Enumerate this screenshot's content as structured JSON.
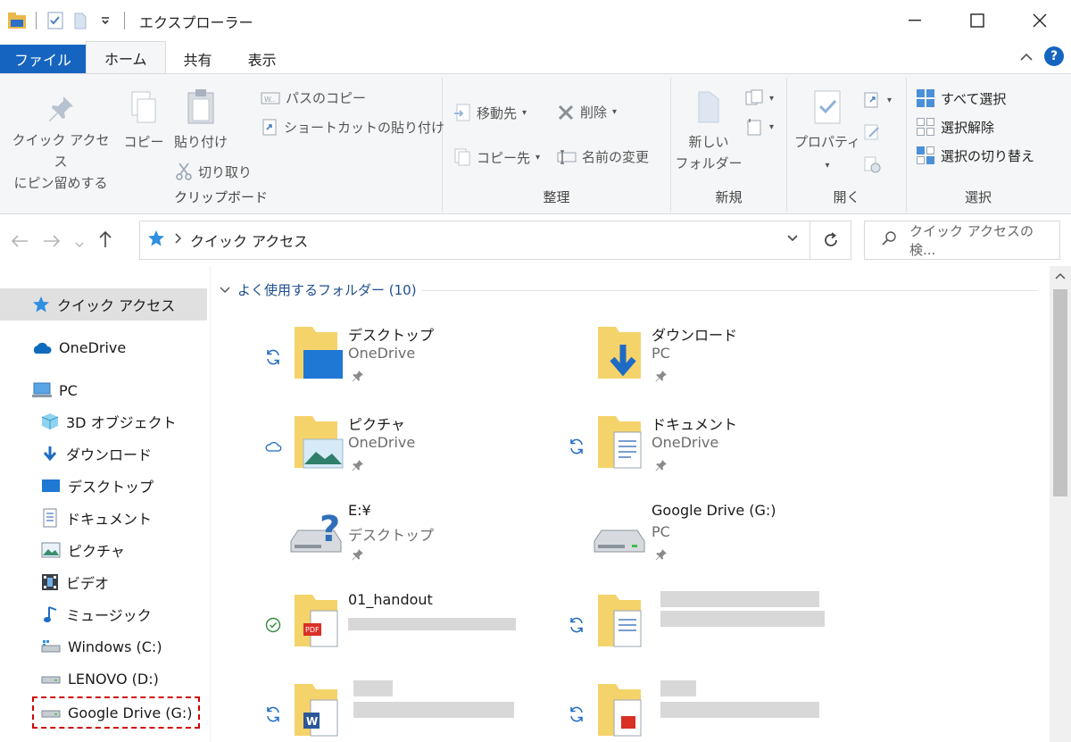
{
  "window": {
    "title": "エクスプローラー",
    "controls": {
      "minimize": "—",
      "maximize": "☐",
      "close": "✕"
    }
  },
  "tabs": [
    {
      "label": "ファイル"
    },
    {
      "label": "ホーム"
    },
    {
      "label": "共有"
    },
    {
      "label": "表示"
    }
  ],
  "help_label": "?",
  "ribbon": {
    "clipboard": {
      "pin_line1": "クイック アクセス",
      "pin_line2": "にピン留めする",
      "copy": "コピー",
      "paste": "貼り付け",
      "copy_path": "パスのコピー",
      "paste_shortcut": "ショートカットの貼り付け",
      "cut": "切り取り",
      "label": "クリップボード"
    },
    "organize": {
      "move_to": "移動先",
      "delete": "削除",
      "copy_to": "コピー先",
      "rename": "名前の変更",
      "label": "整理"
    },
    "new": {
      "new_folder_line1": "新しい",
      "new_folder_line2": "フォルダー",
      "label": "新規"
    },
    "open": {
      "properties": "プロパティ",
      "label": "開く"
    },
    "select": {
      "select_all": "すべて選択",
      "select_none": "選択解除",
      "invert": "選択の切り替え",
      "label": "選択"
    }
  },
  "address": {
    "path": "クイック アクセス",
    "search_placeholder": "クイック アクセスの検..."
  },
  "sidebar": {
    "items": [
      {
        "label": "クイック アクセス",
        "icon": "star-icon"
      },
      {
        "label": "OneDrive",
        "icon": "cloud-icon"
      },
      {
        "label": "PC",
        "icon": "pc-icon"
      },
      {
        "label": "3D オブジェクト",
        "icon": "cube-icon"
      },
      {
        "label": "ダウンロード",
        "icon": "download-icon"
      },
      {
        "label": "デスクトップ",
        "icon": "desktop-icon"
      },
      {
        "label": "ドキュメント",
        "icon": "document-icon"
      },
      {
        "label": "ピクチャ",
        "icon": "picture-icon"
      },
      {
        "label": "ビデオ",
        "icon": "video-icon"
      },
      {
        "label": "ミュージック",
        "icon": "music-icon"
      },
      {
        "label": "Windows (C:)",
        "icon": "drive-icon"
      },
      {
        "label": "LENOVO (D:)",
        "icon": "drive-icon"
      },
      {
        "label": "Google Drive (G:)",
        "icon": "drive-icon"
      }
    ]
  },
  "content": {
    "group_title": "よく使用するフォルダー (10)",
    "tiles": [
      {
        "name": "デスクトップ",
        "sub": "OneDrive"
      },
      {
        "name": "ダウンロード",
        "sub": "PC"
      },
      {
        "name": "ピクチャ",
        "sub": "OneDrive"
      },
      {
        "name": "ドキュメント",
        "sub": "OneDrive"
      },
      {
        "name": "E:¥",
        "sub": "デスクトップ"
      },
      {
        "name": "Google Drive (G:)",
        "sub": "PC"
      },
      {
        "name": "01_handout",
        "sub": ""
      }
    ]
  },
  "colors": {
    "accent": "#1565c0",
    "folder_yellow": "#f5d36b",
    "sync_blue": "#1e6bc4",
    "ok_green": "#2e8b3a",
    "highlight_red": "#d00000"
  }
}
